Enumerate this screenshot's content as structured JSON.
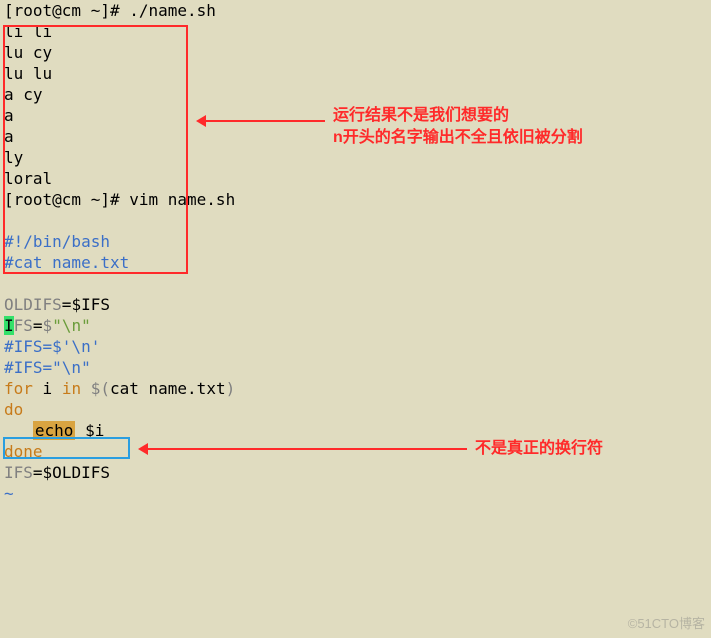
{
  "terminal": {
    "prompt1": "[root@cm ~]# ",
    "cmd1": "./name.sh",
    "output": [
      "li li",
      "lu cy",
      "lu lu",
      "",
      "a cy",
      "",
      "a",
      "a",
      "ly",
      "loral"
    ],
    "prompt2": "[root@cm ~]# ",
    "cmd2": "vim name.sh"
  },
  "script": {
    "l1": "#!/bin/bash",
    "l2": "#cat name.txt",
    "l3_oldifs_lhs": "OLDIFS",
    "l3_oldifs_eq": "=",
    "l3_oldifs_rhs": "$IFS",
    "l4_cursor": "I",
    "l4_fs": "FS",
    "l4_eq": "=",
    "l4_dollar": "$",
    "l4_str": "\"\\n\"",
    "l5": "#IFS=$'\\n'",
    "l6": "#IFS=\"\\n\"",
    "l7_for": "for",
    "l7_var": " i ",
    "l7_in": "in",
    "l7_rest_a": " $(",
    "l7_rest_b": "cat name.txt",
    "l7_rest_c": ")",
    "l8_do": "do",
    "l9_pad": "   ",
    "l9_echo": "echo",
    "l9_arg": " $i",
    "l10_done": "done",
    "l11_lhs": "IFS",
    "l11_eq": "=",
    "l11_rhs": "$OLDIFS",
    "tilde": "~"
  },
  "annotations": {
    "top1": "运行结果不是我们想要的",
    "top2": "n开头的名字输出不全且依旧被分割",
    "ifs": "不是真正的换行符"
  },
  "watermark": "©51CTO博客"
}
